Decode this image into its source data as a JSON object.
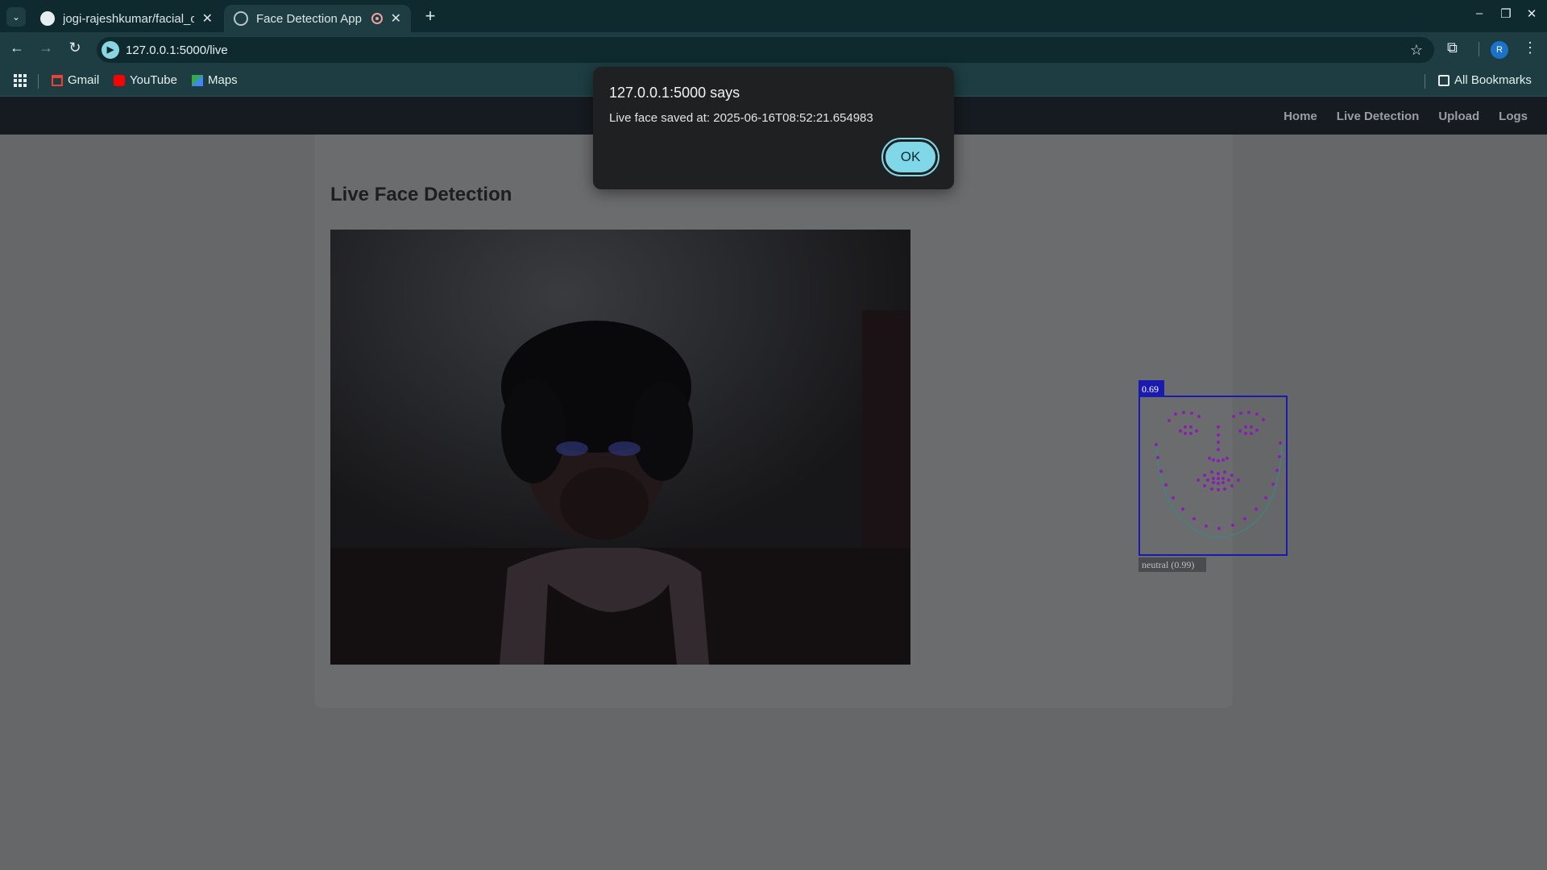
{
  "browser": {
    "tabs": [
      {
        "title": "jogi-rajeshkumar/facial_c"
      },
      {
        "title": "Face Detection App"
      }
    ],
    "url": "127.0.0.1:5000/live",
    "profile_initial": "R",
    "bookmarks": [
      {
        "label": "Gmail"
      },
      {
        "label": "YouTube"
      },
      {
        "label": "Maps"
      }
    ],
    "all_bookmarks_label": "All Bookmarks"
  },
  "navbar": {
    "links": [
      "Home",
      "Live Detection",
      "Upload",
      "Logs"
    ]
  },
  "main": {
    "heading": "Live Face Detection"
  },
  "overlay": {
    "score": "0.69",
    "expression": "neutral (0.99)"
  },
  "dialog": {
    "title": "127.0.0.1:5000 says",
    "message": "Live face saved at: 2025-06-16T08:52:21.654983",
    "ok_label": "OK"
  },
  "colors": {
    "box": "#1a1ab0",
    "landmark": "#8a1fb0",
    "ok_button": "#7fd7e8"
  }
}
